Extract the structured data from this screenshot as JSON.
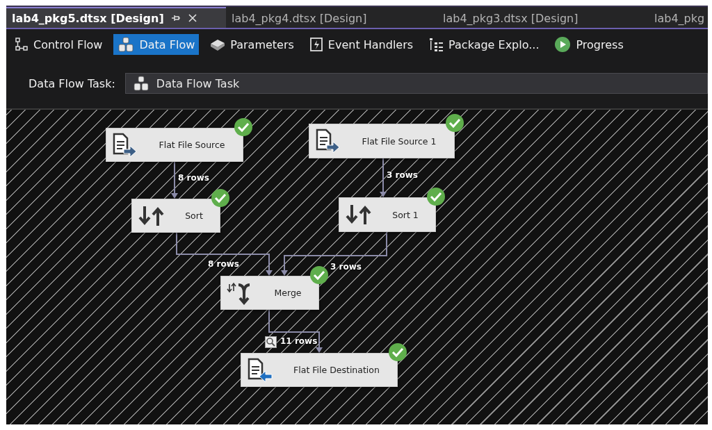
{
  "tabs": [
    {
      "label": "lab4_pkg5.dtsx [Design]",
      "selected": true
    },
    {
      "label": "lab4_pkg4.dtsx [Design]",
      "selected": false
    },
    {
      "label": "lab4_pkg3.dtsx [Design]",
      "selected": false
    },
    {
      "label": "lab4_pkg",
      "selected": false
    }
  ],
  "toolbar": [
    {
      "label": "Control Flow",
      "kind": "control",
      "selected": false
    },
    {
      "label": "Data Flow",
      "kind": "dataflow",
      "selected": true
    },
    {
      "label": "Parameters",
      "kind": "parameters",
      "selected": false
    },
    {
      "label": "Event Handlers",
      "kind": "events",
      "selected": false
    },
    {
      "label": "Package Explo...",
      "kind": "explorer",
      "selected": false
    },
    {
      "label": "Progress",
      "kind": "progress",
      "selected": false
    }
  ],
  "task_selector": {
    "label": "Data Flow Task:",
    "value": "Data Flow Task"
  },
  "nodes": [
    {
      "name": "Flat File Source",
      "kind": "source",
      "succeeded": true
    },
    {
      "name": "Flat File Source 1",
      "kind": "source",
      "succeeded": true
    },
    {
      "name": "Sort",
      "kind": "sort",
      "succeeded": true
    },
    {
      "name": "Sort 1",
      "kind": "sort",
      "succeeded": true
    },
    {
      "name": "Merge",
      "kind": "merge",
      "succeeded": true
    },
    {
      "name": "Flat File Destination",
      "kind": "destination",
      "succeeded": true
    }
  ],
  "paths": [
    {
      "label": "8 rows",
      "data_viewer": false
    },
    {
      "label": "3 rows",
      "data_viewer": false
    },
    {
      "label": "8 rows",
      "data_viewer": false
    },
    {
      "label": "3 rows",
      "data_viewer": false
    },
    {
      "label": "11 rows",
      "data_viewer": true
    }
  ]
}
